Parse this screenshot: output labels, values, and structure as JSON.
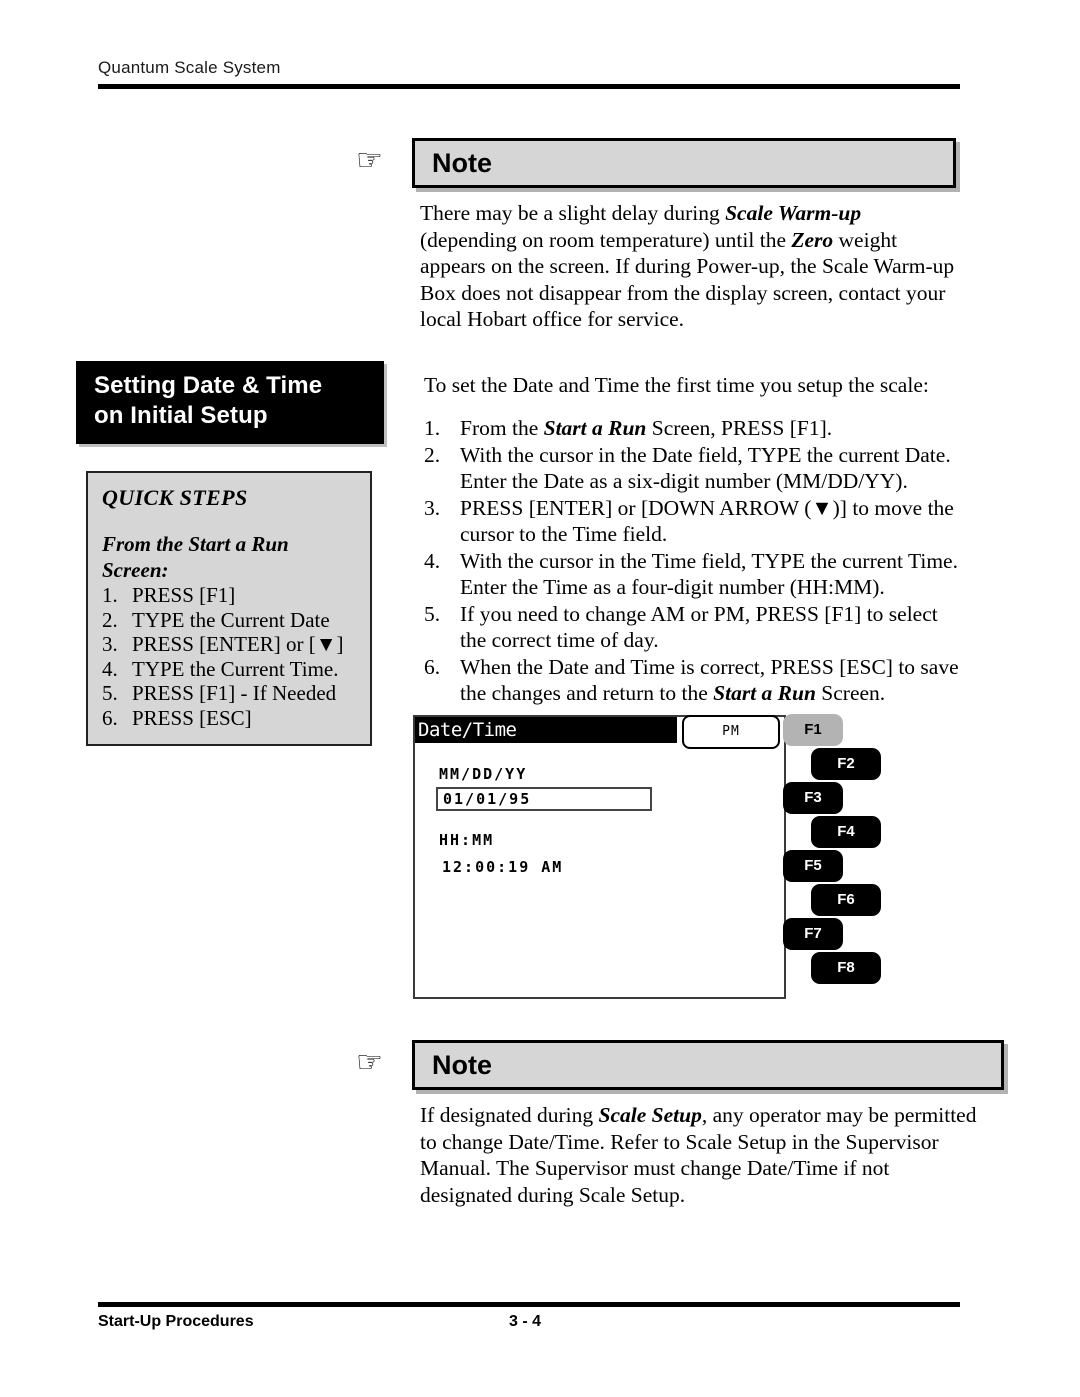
{
  "header": {
    "title": "Quantum Scale System"
  },
  "note_top": {
    "icon": "pointing-hand-icon",
    "title": "Note",
    "paragraph_parts": [
      {
        "text": "There may be a slight delay during ",
        "style": "normal"
      },
      {
        "text": "Scale Warm-up",
        "style": "bold-italic"
      },
      {
        "text": " (depending on room temperature) until the ",
        "style": "normal"
      },
      {
        "text": "Zero",
        "style": "bold-italic"
      },
      {
        "text": " weight appears on the screen.  If during Power-up, the Scale Warm-up Box does not disappear from the display screen, contact your local Hobart office for service.",
        "style": "normal"
      }
    ]
  },
  "section": {
    "heading_line1": "Setting Date & Time",
    "heading_line2": "on Initial Setup"
  },
  "quick_steps": {
    "title": "QUICK STEPS",
    "subtitle": "From the Start a Run Screen:",
    "items": [
      {
        "num": "1.",
        "text": "PRESS [F1]"
      },
      {
        "num": "2.",
        "text": "TYPE the Current Date"
      },
      {
        "num": "3.",
        "text": "PRESS [ENTER] or [▼]"
      },
      {
        "num": "4.",
        "text": "TYPE the Current Time."
      },
      {
        "num": "5.",
        "text": "PRESS [F1] - If Needed"
      },
      {
        "num": "6.",
        "text": "PRESS [ESC]"
      }
    ]
  },
  "procedure": {
    "lead": "To set the Date and Time the first time you setup the scale:",
    "steps": [
      {
        "num": "1.",
        "parts": [
          {
            "text": "From the ",
            "style": "normal"
          },
          {
            "text": "Start a Run",
            "style": "bold-italic"
          },
          {
            "text": " Screen, PRESS [F1].",
            "style": "normal"
          }
        ]
      },
      {
        "num": "2.",
        "parts": [
          {
            "text": "With the cursor in the Date field, TYPE the current Date. Enter the Date as a six-digit number  (MM/DD/YY).",
            "style": "normal"
          }
        ]
      },
      {
        "num": "3.",
        "parts": [
          {
            "text": "PRESS [ENTER] or [DOWN ARROW (▼)] to move the cursor to the Time field.",
            "style": "normal"
          }
        ]
      },
      {
        "num": "4.",
        "parts": [
          {
            "text": "With the cursor in the Time field, TYPE the current Time.  Enter the Time as a four-digit number  (HH:MM).",
            "style": "normal"
          }
        ]
      },
      {
        "num": "5.",
        "parts": [
          {
            "text": "If you need to change AM or PM, PRESS [F1] to select the correct time of day.",
            "style": "normal"
          }
        ]
      },
      {
        "num": "6.",
        "parts": [
          {
            "text": "When the Date and Time is correct, PRESS [ESC] to save the changes and return to the ",
            "style": "normal"
          },
          {
            "text": "Start a Run",
            "style": "bold-italic"
          },
          {
            "text": " Screen.",
            "style": "normal"
          }
        ]
      }
    ]
  },
  "scale_screen": {
    "title": "Date/Time",
    "date_label": "MM/DD/YY",
    "date_value": "01/01/95",
    "time_label": "HH:MM",
    "time_value": "12:00:19  AM",
    "softkey_label": "PM",
    "fkeys": [
      {
        "label": "F1",
        "selected": true
      },
      {
        "label": "F2",
        "selected": false
      },
      {
        "label": "F3",
        "selected": false
      },
      {
        "label": "F4",
        "selected": false
      },
      {
        "label": "F5",
        "selected": false
      },
      {
        "label": "F6",
        "selected": false
      },
      {
        "label": "F7",
        "selected": false
      },
      {
        "label": "F8",
        "selected": false
      }
    ]
  },
  "note_bottom": {
    "icon": "pointing-hand-icon",
    "title": "Note",
    "paragraph_parts": [
      {
        "text": "If designated during ",
        "style": "normal"
      },
      {
        "text": "Scale Setup",
        "style": "bold-italic"
      },
      {
        "text": ", any operator may be permitted to change Date/Time.  Refer to Scale Setup in the Supervisor Manual.  The Supervisor must change Date/Time if not designated during Scale Setup.",
        "style": "normal"
      }
    ]
  },
  "footer": {
    "left": "Start-Up Procedures",
    "page": "3 - 4"
  }
}
